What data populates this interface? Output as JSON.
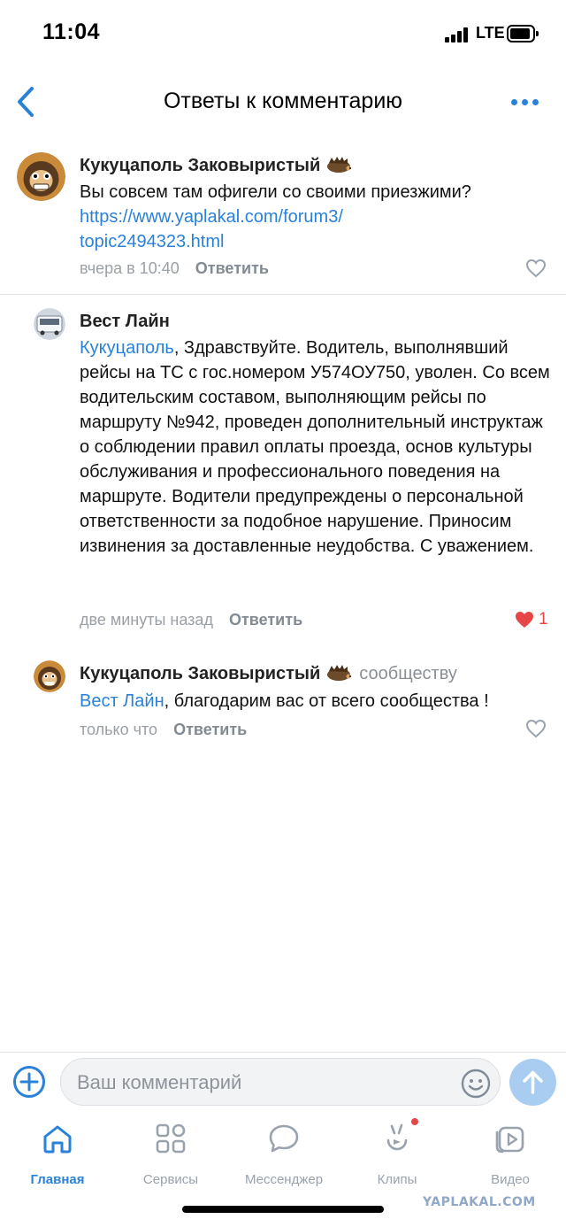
{
  "status_bar": {
    "time": "11:04",
    "network": "LTE"
  },
  "header": {
    "title": "Ответы к комментарию",
    "back_icon": "chevron-left-icon",
    "more_icon": "ellipsis-icon"
  },
  "comments": [
    {
      "author": "Кукуцаполь Заковыристый",
      "text": "Вы совсем там офигели со своими приезжими?",
      "link_line1": "https://www.yaplakal.com/forum3/",
      "link_line2": "topic2494323.html",
      "time": "вчера в 10:40",
      "reply_label": "Ответить",
      "liked": false
    },
    {
      "author": "Вест Лайн",
      "mention": "Кукуцаполь",
      "text": ", Здравствуйте. Водитель, выполнявший рейсы на ТС с гос.номером У574ОУ750, уволен. Со всем водительским составом, выполняющим рейсы по маршруту №942, проведен дополнительный инструктаж о соблюдении правил оплаты проезда, основ культуры обслуживания и профессионального поведения на маршруте. Водители предупреждены о персональной ответственности за подобное нарушение. Приносим извинения за доставленные неудобства. С уважением.",
      "time": "две минуты назад",
      "reply_label": "Ответить",
      "liked": true,
      "likes": "1"
    },
    {
      "author": "Кукуцаполь Заковыристый",
      "to": "сообществу",
      "mention": "Вест Лайн",
      "text": ", благодарим вас от всего сообщества !",
      "time": "только что",
      "reply_label": "Ответить",
      "liked": false
    }
  ],
  "composer": {
    "placeholder": "Ваш комментарий"
  },
  "tabs": [
    {
      "label": "Главная",
      "icon": "home-icon",
      "active": true
    },
    {
      "label": "Сервисы",
      "icon": "services-grid-icon"
    },
    {
      "label": "Мессенджер",
      "icon": "chat-bubble-icon"
    },
    {
      "label": "Клипы",
      "icon": "clips-icon",
      "badge": true
    },
    {
      "label": "Видео",
      "icon": "video-icon"
    }
  ],
  "watermark": "YAPLAKAL.COM",
  "colors": {
    "accent": "#2a81d8",
    "like_red": "#e64646",
    "muted": "#99a2ad"
  }
}
